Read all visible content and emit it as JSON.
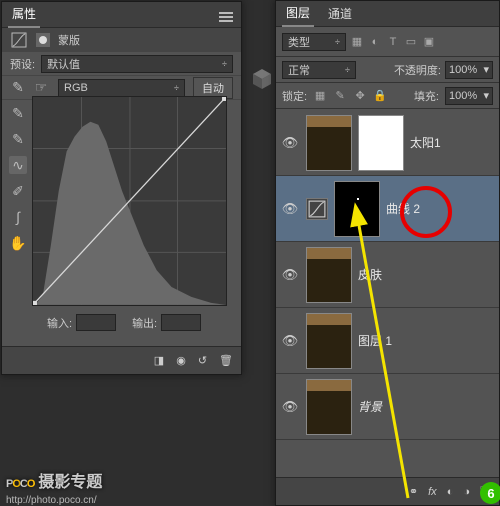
{
  "props": {
    "tab1": "属性",
    "title_curves": "蒙版",
    "preset_label": "预设:",
    "preset_value": "默认值",
    "channel_value": "RGB",
    "auto_btn": "自动",
    "input_label": "输入:",
    "output_label": "输出:"
  },
  "layers_panel": {
    "tab1": "图层",
    "tab2": "通道",
    "kind_label": "类型",
    "blend_mode": "正常",
    "opacity_label": "不透明度:",
    "opacity_value": "100%",
    "lock_label": "锁定:",
    "fill_label": "填充:",
    "fill_value": "100%"
  },
  "layers": [
    {
      "name": "太阳1"
    },
    {
      "name": "曲线 2"
    },
    {
      "name": "皮肤"
    },
    {
      "name": "图层 1"
    },
    {
      "name": "背景"
    }
  ],
  "watermark": {
    "brand_p": "P",
    "brand_o": "O",
    "brand_c": "C",
    "brand_o2": "O",
    "sub": "摄影专题",
    "url": "http://photo.poco.cn/"
  },
  "green_badge": "6"
}
